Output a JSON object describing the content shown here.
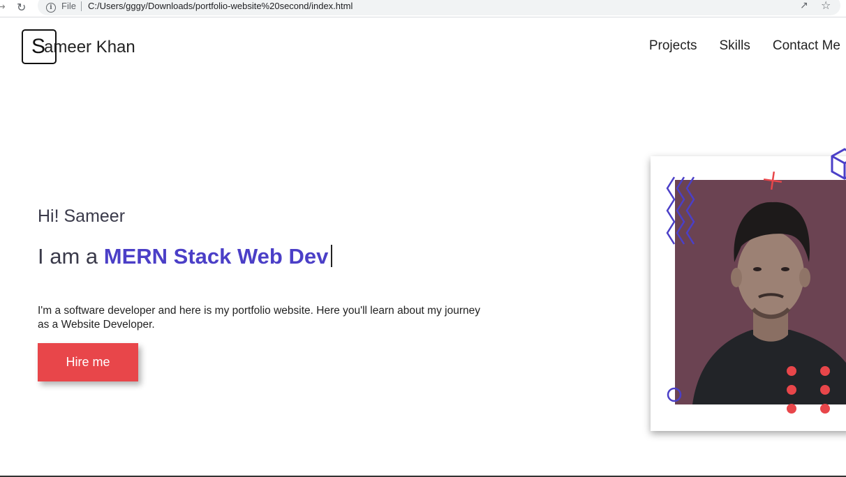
{
  "browser": {
    "file_label": "File",
    "url": "C:/Users/gggy/Downloads/portfolio-website%20second/index.html"
  },
  "logo": {
    "initial": "S",
    "rest": "ameer Khan"
  },
  "nav": {
    "items": [
      "Projects",
      "Skills",
      "Contact Me"
    ]
  },
  "hero": {
    "greeting": "Hi! Sameer",
    "prefix": "I am a ",
    "role": "MERN Stack Web Dev",
    "description": "I'm a software developer and here is my portfolio website. Here you'll learn about my journey as a Website Developer.",
    "cta_label": "Hire me"
  },
  "colors": {
    "accent": "#4b3fc7",
    "cta": "#e8464a",
    "photo_bg": "#6b4352"
  }
}
